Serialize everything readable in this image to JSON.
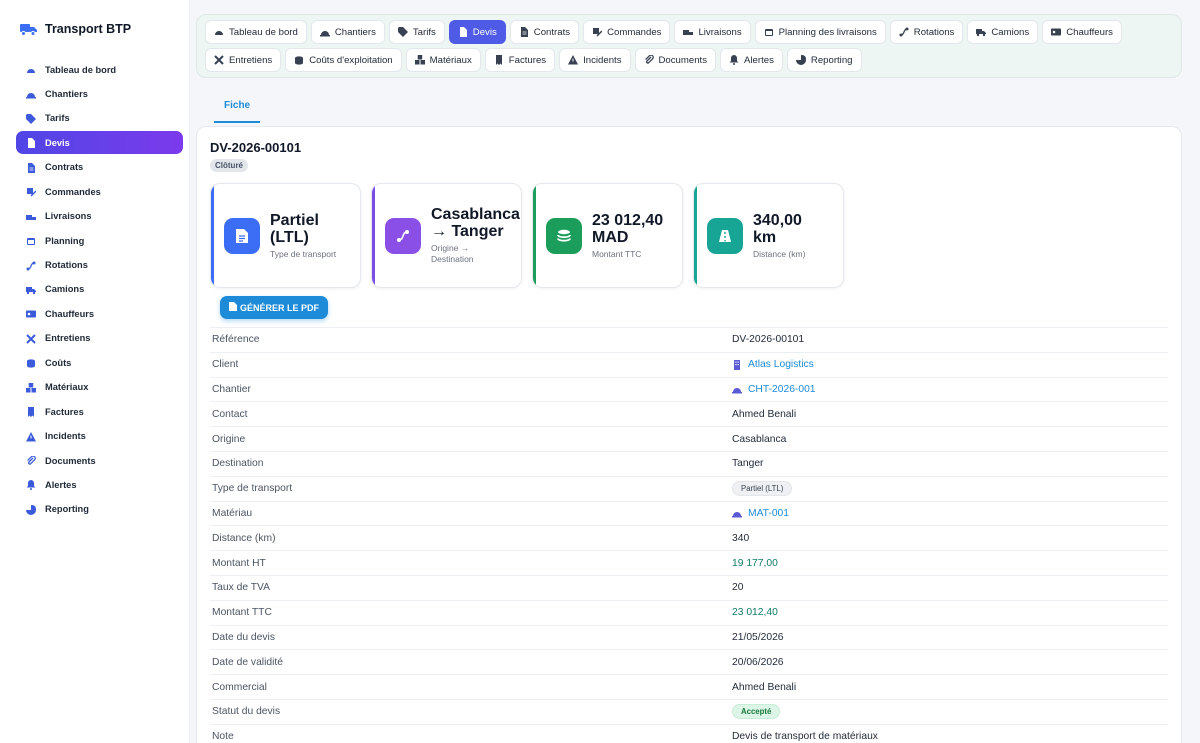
{
  "app": {
    "name": "Transport BTP"
  },
  "sidebar": {
    "items": [
      {
        "label": "Tableau de bord",
        "icon": "dashboard-icon"
      },
      {
        "label": "Chantiers",
        "icon": "hardhat-icon"
      },
      {
        "label": "Tarifs",
        "icon": "tag-icon"
      },
      {
        "label": "Devis",
        "icon": "file-icon",
        "active": true
      },
      {
        "label": "Contrats",
        "icon": "file-contract-icon"
      },
      {
        "label": "Commandes",
        "icon": "order-icon"
      },
      {
        "label": "Livraisons",
        "icon": "truck-loading-icon"
      },
      {
        "label": "Planning",
        "icon": "calendar-icon"
      },
      {
        "label": "Rotations",
        "icon": "route-icon"
      },
      {
        "label": "Camions",
        "icon": "truck-icon"
      },
      {
        "label": "Chauffeurs",
        "icon": "id-card-icon"
      },
      {
        "label": "Entretiens",
        "icon": "tools-icon"
      },
      {
        "label": "Coûts",
        "icon": "coins-icon"
      },
      {
        "label": "Matériaux",
        "icon": "cubes-icon"
      },
      {
        "label": "Factures",
        "icon": "invoice-icon"
      },
      {
        "label": "Incidents",
        "icon": "warning-icon"
      },
      {
        "label": "Documents",
        "icon": "paperclip-icon"
      },
      {
        "label": "Alertes",
        "icon": "bell-icon"
      },
      {
        "label": "Reporting",
        "icon": "chart-pie-icon"
      }
    ]
  },
  "topnav": {
    "row1": [
      {
        "label": "Tableau de bord"
      },
      {
        "label": "Chantiers"
      },
      {
        "label": "Tarifs"
      },
      {
        "label": "Devis",
        "active": true
      },
      {
        "label": "Contrats"
      },
      {
        "label": "Commandes"
      },
      {
        "label": "Livraisons"
      },
      {
        "label": "Planning des livraisons"
      },
      {
        "label": "Rotations"
      },
      {
        "label": "Camions"
      },
      {
        "label": "Chauffeurs"
      }
    ],
    "row2": [
      {
        "label": "Entretiens"
      },
      {
        "label": "Coûts d'exploitation"
      },
      {
        "label": "Matériaux"
      },
      {
        "label": "Factures"
      },
      {
        "label": "Incidents"
      },
      {
        "label": "Documents"
      },
      {
        "label": "Alertes"
      },
      {
        "label": "Reporting"
      }
    ]
  },
  "subtab": {
    "label": "Fiche"
  },
  "record": {
    "title": "DV-2026-00101",
    "status": "Clôturé",
    "pdf_button": "GÉNÉRER LE PDF"
  },
  "kpis": [
    {
      "value": "Partiel (LTL)",
      "label": "Type de transport",
      "icon": "file-icon"
    },
    {
      "value": "Casablanca → Tanger",
      "label": "Origine → Destination",
      "icon": "route-icon"
    },
    {
      "value": "23 012,40 MAD",
      "label": "Montant TTC",
      "icon": "coins-icon"
    },
    {
      "value": "340,00 km",
      "label": "Distance (km)",
      "icon": "road-icon"
    }
  ],
  "details": [
    {
      "key": "Référence",
      "value": "DV-2026-00101"
    },
    {
      "key": "Client",
      "value": "Atlas Logistics",
      "kind": "link",
      "icon": "building-icon"
    },
    {
      "key": "Chantier",
      "value": "CHT-2026-001",
      "kind": "link",
      "icon": "hardhat-icon"
    },
    {
      "key": "Contact",
      "value": "Ahmed Benali"
    },
    {
      "key": "Origine",
      "value": "Casablanca"
    },
    {
      "key": "Destination",
      "value": "Tanger"
    },
    {
      "key": "Type de transport",
      "value": "Partiel (LTL)",
      "kind": "pill"
    },
    {
      "key": "Matériau",
      "value": "MAT-001",
      "kind": "link",
      "icon": "hardhat-icon"
    },
    {
      "key": "Distance (km)",
      "value": "340"
    },
    {
      "key": "Montant HT",
      "value": "19 177,00",
      "kind": "money"
    },
    {
      "key": "Taux de TVA",
      "value": "20"
    },
    {
      "key": "Montant TTC",
      "value": "23 012,40",
      "kind": "money"
    },
    {
      "key": "Date du devis",
      "value": "21/05/2026"
    },
    {
      "key": "Date de validité",
      "value": "20/06/2026"
    },
    {
      "key": "Commercial",
      "value": "Ahmed Benali"
    },
    {
      "key": "Statut du devis",
      "value": "Accepté",
      "kind": "pill-green"
    },
    {
      "key": "Note",
      "value": "Devis de transport de matériaux"
    }
  ],
  "colors": {
    "accent": "#4f46e5",
    "link": "#1d8bd8",
    "money": "#0f7a64"
  }
}
